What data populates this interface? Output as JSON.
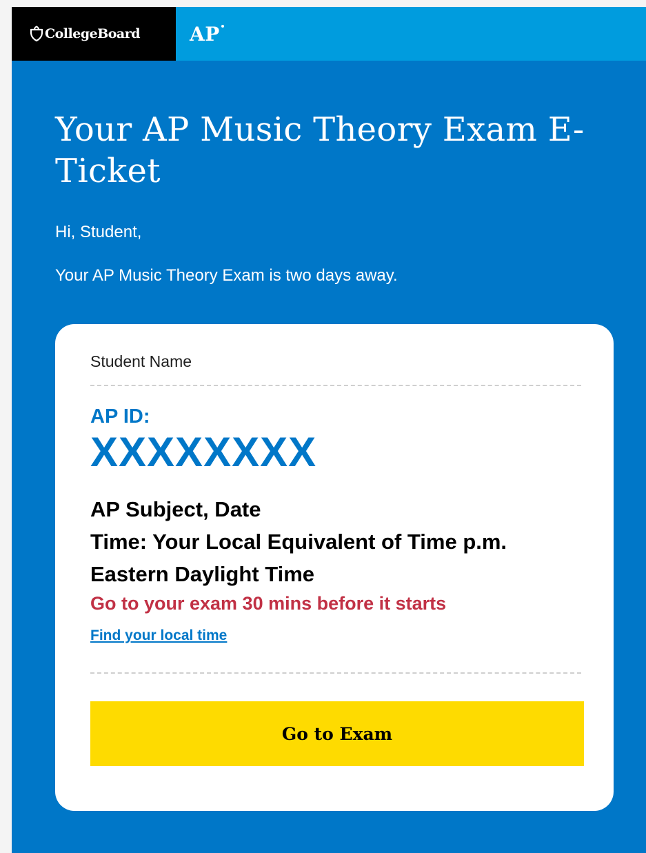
{
  "header": {
    "collegeboard_logo": "CollegeBoard",
    "ap_logo": "AP",
    "icon": "acorn-icon"
  },
  "main": {
    "headline": "Your AP Music Theory Exam E-Ticket",
    "greeting": "Hi, Student,",
    "intro": "Your AP Music Theory Exam is two days away."
  },
  "ticket": {
    "student_name": "Student Name",
    "ap_id_label": "AP ID:",
    "ap_id_value": "XXXXXXXX",
    "subject_date": "AP Subject, Date",
    "time_line": "Time: Your Local Equivalent of Time p.m.",
    "timezone": "Eastern Daylight Time",
    "arrive_note": "Go to your exam 30 mins before it starts",
    "local_time_link": "Find your local time",
    "exam_button": "Go to Exam"
  },
  "colors": {
    "background_blue": "#0077c8",
    "ap_bar_blue": "#009cde",
    "header_black": "#000000",
    "accent_red": "#c13145",
    "button_yellow": "#fedb00"
  }
}
